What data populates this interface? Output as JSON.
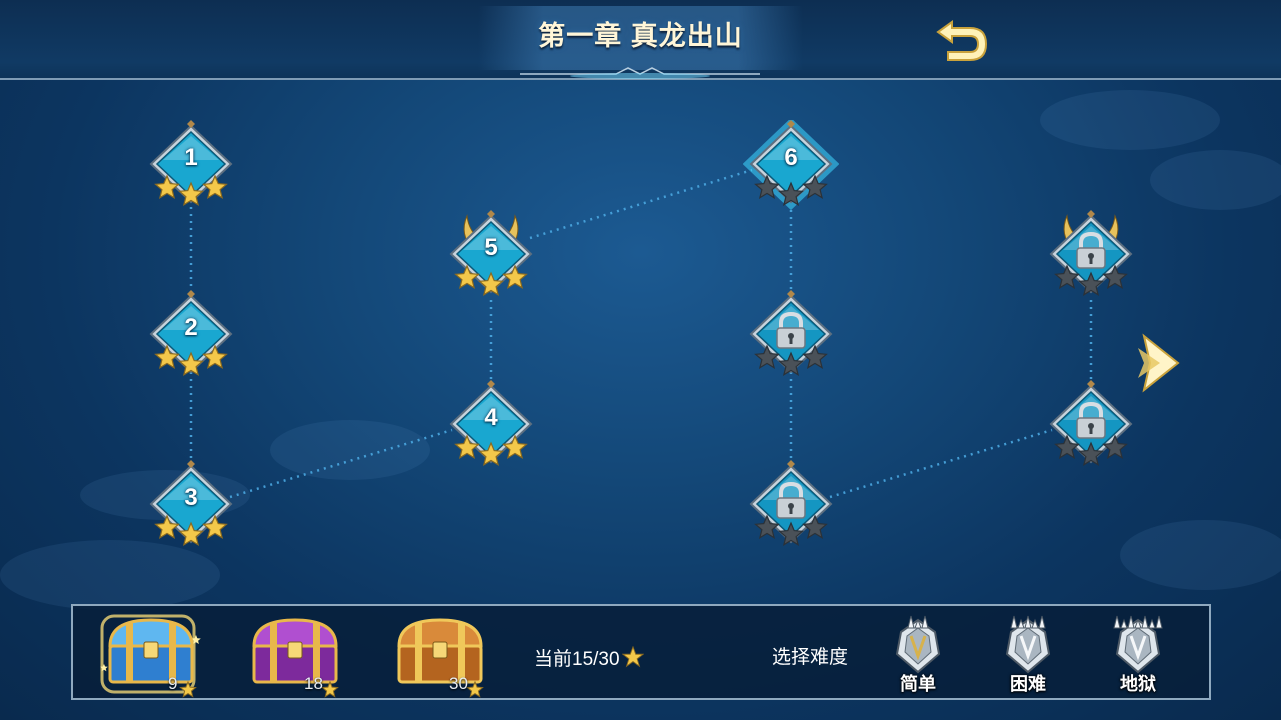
{
  "chapter_title": "第一章 真龙出山",
  "stages": [
    {
      "label": "1",
      "stars": 3,
      "locked": false,
      "current": false,
      "boss": false
    },
    {
      "label": "2",
      "stars": 3,
      "locked": false,
      "current": false,
      "boss": false
    },
    {
      "label": "3",
      "stars": 3,
      "locked": false,
      "current": false,
      "boss": false
    },
    {
      "label": "4",
      "stars": 3,
      "locked": false,
      "current": false,
      "boss": false
    },
    {
      "label": "5",
      "stars": 3,
      "locked": false,
      "current": false,
      "boss": true
    },
    {
      "label": "6",
      "stars": 0,
      "locked": false,
      "current": true,
      "boss": false
    },
    {
      "label": "",
      "stars": 0,
      "locked": true,
      "current": false,
      "boss": false
    },
    {
      "label": "",
      "stars": 0,
      "locked": true,
      "current": false,
      "boss": false
    },
    {
      "label": "",
      "stars": 0,
      "locked": true,
      "current": false,
      "boss": false
    },
    {
      "label": "",
      "stars": 0,
      "locked": true,
      "current": false,
      "boss": true
    }
  ],
  "rewards": {
    "chests": [
      {
        "required": "9",
        "color": "blue",
        "highlighted": true
      },
      {
        "required": "18",
        "color": "purple",
        "highlighted": false
      },
      {
        "required": "30",
        "color": "gold",
        "highlighted": false
      }
    ],
    "current_text": "当前15/30"
  },
  "difficulty": {
    "label": "选择难度",
    "options": [
      "简单",
      "困难",
      "地狱"
    ]
  },
  "colors": {
    "gold": "#f3c84a",
    "node_cyan": "#19a7d0",
    "selected_glow": "#3fd7ff",
    "locked_gray": "#7e8a96"
  },
  "icons": {
    "back": "return-arrow-icon",
    "next": "chevron-right-icon",
    "lock": "padlock-icon",
    "star": "star-icon"
  }
}
